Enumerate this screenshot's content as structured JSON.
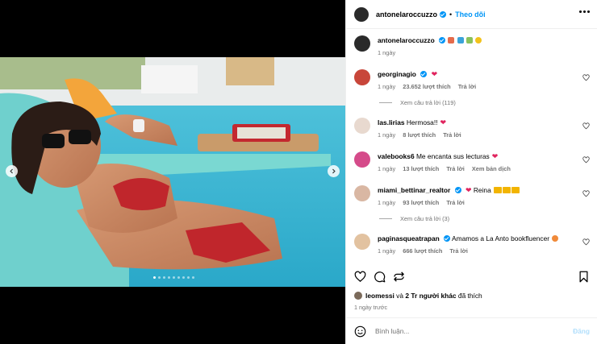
{
  "post": {
    "author": "antonelaroccuzzo",
    "follow_label": "Theo dõi",
    "separator": "•",
    "caption_author": "antonelaroccuzzo",
    "caption_time": "1 ngày"
  },
  "comments": [
    {
      "user": "georginagio",
      "text": "",
      "time": "1 ngày",
      "likes": "23.652 lượt thích",
      "reply": "Trả lời",
      "verified": true,
      "view_replies": "Xem câu trả lời (119)"
    },
    {
      "user": "las.lirias",
      "text": "Hermosa!!",
      "time": "1 ngày",
      "likes": "8 lượt thích",
      "reply": "Trả lời",
      "verified": false
    },
    {
      "user": "valebooks6",
      "text": "Me encanta sus lecturas",
      "time": "1 ngày",
      "likes": "13 lượt thích",
      "reply": "Trả lời",
      "translate": "Xem bản dịch",
      "verified": false
    },
    {
      "user": "miami_bettinar_realtor",
      "text": "Reina",
      "time": "1 ngày",
      "likes": "93 lượt thích",
      "reply": "Trả lời",
      "verified": true,
      "view_replies": "Xem câu trả lời (3)"
    },
    {
      "user": "paginasqueatrapan",
      "text": "Amamos a La Anto bookfluencer",
      "time": "1 ngày",
      "likes": "666 lượt thích",
      "reply": "Trả lời",
      "verified": true
    }
  ],
  "likes_summary": {
    "user": "leomessi",
    "middle": " và ",
    "others": "2 Tr người khác",
    "suffix": " đã thích"
  },
  "time_ago": "1 ngày trước",
  "comment_box": {
    "placeholder": "Bình luận...",
    "post_label": "Đăng"
  },
  "icons": [
    "heart-icon",
    "comment-icon",
    "share-icon",
    "save-icon",
    "emoji-icon",
    "more-icon",
    "chevron-left-icon",
    "chevron-right-icon"
  ],
  "colors": {
    "accent": "#0095f6",
    "muted": "#737373",
    "heart": "#e0245e"
  },
  "carousel": {
    "slide_count": 9,
    "active_index": 0
  }
}
